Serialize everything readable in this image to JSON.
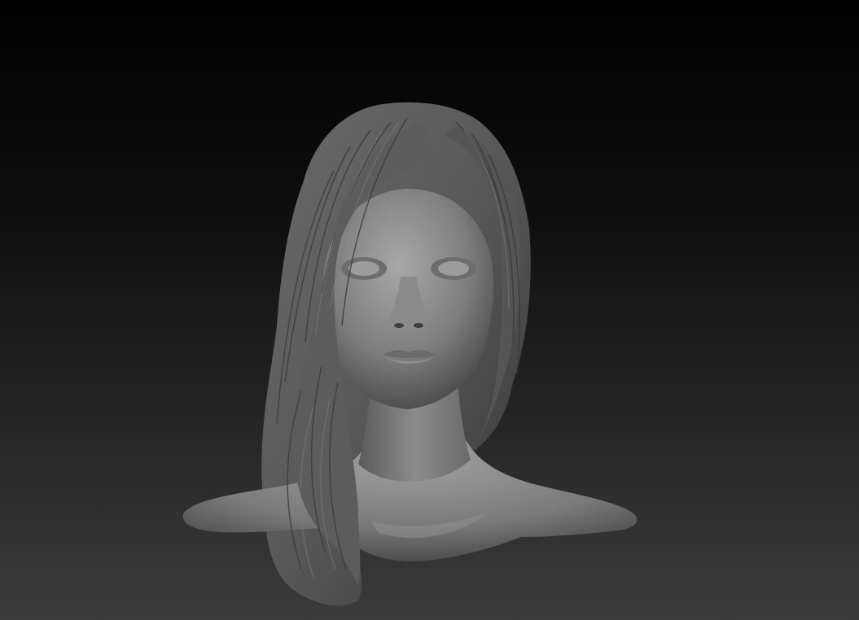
{
  "viewport": {
    "background_top": "#000000",
    "background_bottom": "#3a3a3a"
  },
  "model": {
    "subject": "sculpted-bust",
    "material_light": "#9a9a9a",
    "material_mid": "#6e6e6e",
    "material_dark": "#2e2e2e"
  }
}
